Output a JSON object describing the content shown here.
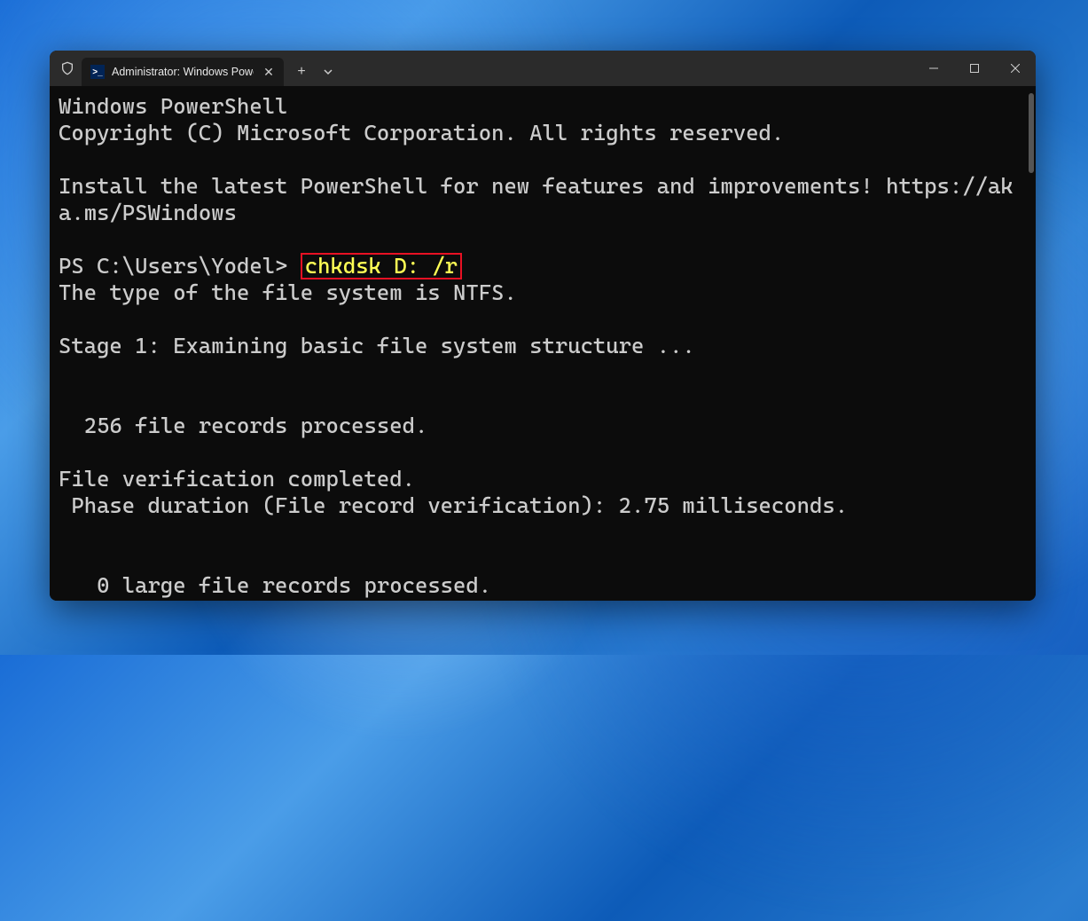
{
  "tab": {
    "title": "Administrator: Windows Powe",
    "icon_label": ">_"
  },
  "terminal": {
    "line1": "Windows PowerShell",
    "line2": "Copyright (C) Microsoft Corporation. All rights reserved.",
    "blank1": "",
    "line3": "Install the latest PowerShell for new features and improvements! https://aka.ms/PSWindows",
    "blank2": "",
    "prompt": "PS C:\\Users\\Yodel> ",
    "command": "chkdsk D: /r",
    "line4": "The type of the file system is NTFS.",
    "blank3": "",
    "line5": "Stage 1: Examining basic file system structure ...",
    "blank4": "",
    "blank5": "",
    "line6": "  256 file records processed.",
    "blank6": "",
    "line7": "File verification completed.",
    "line8": " Phase duration (File record verification): 2.75 milliseconds.",
    "blank7": "",
    "blank8": "",
    "line9": "   0 large file records processed."
  }
}
